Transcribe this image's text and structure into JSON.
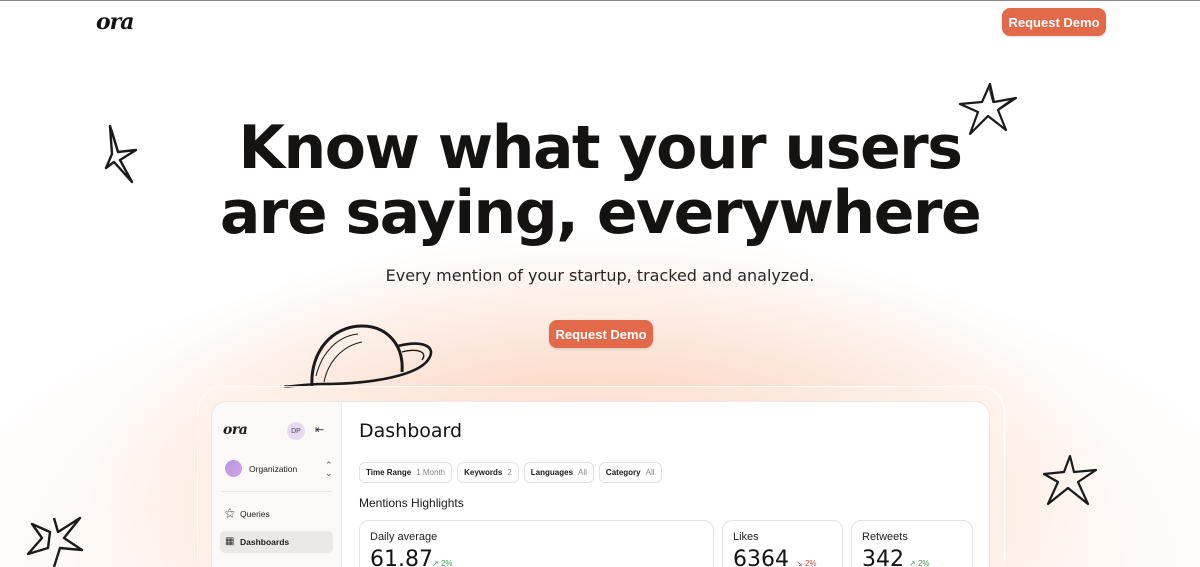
{
  "header": {
    "logo": "ora",
    "cta_label": "Request Demo"
  },
  "hero": {
    "headline_line1": "Know what your users",
    "headline_line2": "are saying, everywhere",
    "subheadline": "Every mention of your startup, tracked and analyzed.",
    "cta_label": "Request Demo"
  },
  "colors": {
    "accent": "#e26a4a",
    "glow": "#f7b08c",
    "text": "#151312"
  },
  "dashboard": {
    "sidebar": {
      "logo": "ora",
      "avatar_initials": "DP",
      "org_label": "Organization",
      "items": [
        {
          "label": "Queries",
          "icon": "magic-wand-icon",
          "active": false
        },
        {
          "label": "Dashboards",
          "icon": "grid-icon",
          "active": true
        }
      ]
    },
    "title": "Dashboard",
    "filters": [
      {
        "key": "Time Range",
        "value": "1 Month"
      },
      {
        "key": "Keywords",
        "value": "2"
      },
      {
        "key": "Languages",
        "value": "All"
      },
      {
        "key": "Category",
        "value": "All"
      }
    ],
    "section_title": "Mentions Highlights",
    "cards": [
      {
        "label": "Daily average",
        "value": "61.87",
        "delta": "2%",
        "trend": "up"
      },
      {
        "label": "Likes",
        "value": "6364",
        "delta": "2%",
        "trend": "down"
      },
      {
        "label": "Retweets",
        "value": "342",
        "delta": "2%",
        "trend": "up"
      }
    ]
  }
}
